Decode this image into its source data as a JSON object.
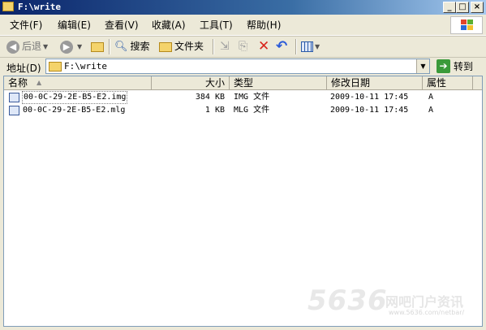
{
  "window": {
    "title": "F:\\write",
    "minimize": "_",
    "maximize": "□",
    "close": "×"
  },
  "menu": [
    {
      "label": "文件(F)"
    },
    {
      "label": "编辑(E)"
    },
    {
      "label": "查看(V)"
    },
    {
      "label": "收藏(A)"
    },
    {
      "label": "工具(T)"
    },
    {
      "label": "帮助(H)"
    }
  ],
  "toolbar": {
    "back_label": "后退",
    "search_label": "搜索",
    "folders_label": "文件夹"
  },
  "address": {
    "label": "地址(D)",
    "value": "F:\\write",
    "go_label": "转到"
  },
  "columns": [
    {
      "label": "名称"
    },
    {
      "label": "大小"
    },
    {
      "label": "类型"
    },
    {
      "label": "修改日期"
    },
    {
      "label": "属性"
    }
  ],
  "files": [
    {
      "name": "00-0C-29-2E-B5-E2.img",
      "size": "384 KB",
      "type": "IMG 文件",
      "modified": "2009-10-11 17:45",
      "attr": "A"
    },
    {
      "name": "00-0C-29-2E-B5-E2.mlg",
      "size": "1 KB",
      "type": "MLG 文件",
      "modified": "2009-10-11 17:45",
      "attr": "A"
    }
  ],
  "watermark": {
    "number": "5636",
    "text": "网吧门户资讯",
    "url": "www.5636.com/netbar/"
  }
}
